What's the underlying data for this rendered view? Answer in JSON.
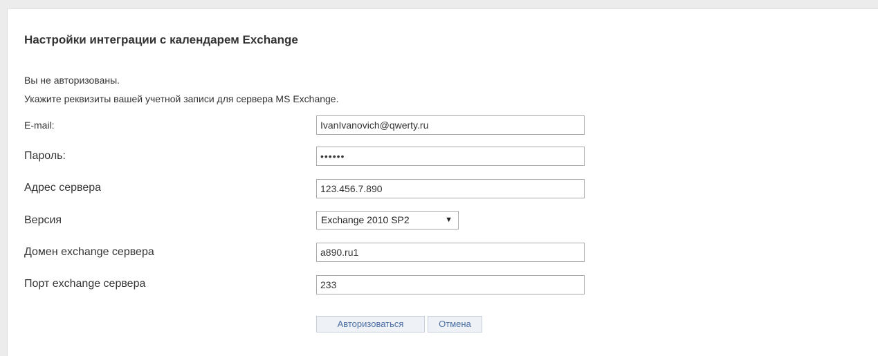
{
  "page": {
    "title": "Настройки интеграции с календарем Exchange",
    "status_line1": "Вы не авторизованы.",
    "status_line2": "Укажите реквизиты вашей учетной записи для сервера MS Exchange."
  },
  "form": {
    "email": {
      "label": "E-mail:",
      "value": "IvanIvanovich@qwerty.ru"
    },
    "password": {
      "label": "Пароль:",
      "value": "••••••"
    },
    "server_address": {
      "label": "Адрес сервера",
      "value": "123.456.7.890"
    },
    "version": {
      "label": "Версия",
      "selected": "Exchange 2010 SP2",
      "arrow": "▼"
    },
    "domain": {
      "label": "Домен exchange сервера",
      "value": "a890.ru1"
    },
    "port": {
      "label": "Порт exchange сервера",
      "value": "233"
    }
  },
  "buttons": {
    "authorize": "Авторизоваться",
    "cancel": "Отмена"
  },
  "icons": {
    "dropdown": "chevron-down-icon"
  }
}
